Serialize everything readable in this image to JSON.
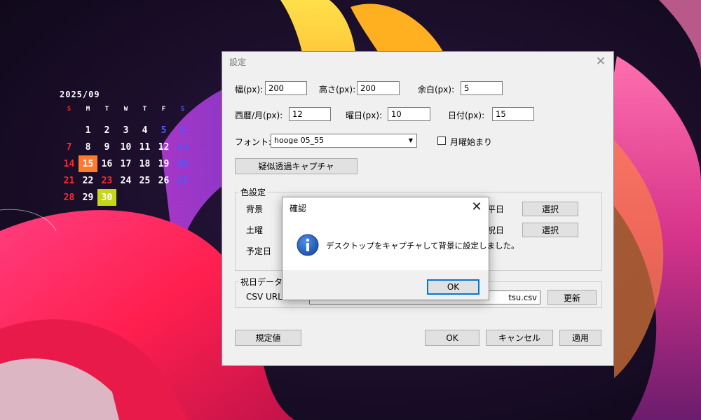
{
  "calendar": {
    "month": "2025/09",
    "weekdays": [
      "S",
      "M",
      "T",
      "W",
      "T",
      "F",
      "S"
    ],
    "days": [
      {
        "d": "",
        "c": ""
      },
      {
        "d": "1",
        "c": ""
      },
      {
        "d": "2",
        "c": ""
      },
      {
        "d": "3",
        "c": ""
      },
      {
        "d": "4",
        "c": ""
      },
      {
        "d": "5",
        "c": "sat"
      },
      {
        "d": "6",
        "c": "sat"
      },
      {
        "d": "7",
        "c": "sun"
      },
      {
        "d": "8",
        "c": ""
      },
      {
        "d": "9",
        "c": ""
      },
      {
        "d": "10",
        "c": ""
      },
      {
        "d": "11",
        "c": ""
      },
      {
        "d": "12",
        "c": ""
      },
      {
        "d": "13",
        "c": "sat"
      },
      {
        "d": "14",
        "c": "sun"
      },
      {
        "d": "15",
        "c": "today"
      },
      {
        "d": "16",
        "c": ""
      },
      {
        "d": "17",
        "c": ""
      },
      {
        "d": "18",
        "c": ""
      },
      {
        "d": "19",
        "c": ""
      },
      {
        "d": "20",
        "c": "sat"
      },
      {
        "d": "21",
        "c": "sun"
      },
      {
        "d": "22",
        "c": ""
      },
      {
        "d": "23",
        "c": "hol"
      },
      {
        "d": "24",
        "c": ""
      },
      {
        "d": "25",
        "c": ""
      },
      {
        "d": "26",
        "c": ""
      },
      {
        "d": "27",
        "c": "sat"
      },
      {
        "d": "28",
        "c": "sun"
      },
      {
        "d": "29",
        "c": ""
      },
      {
        "d": "30",
        "c": "mark"
      }
    ]
  },
  "settings": {
    "title": "設定",
    "width_label": "幅(px):",
    "width_value": "200",
    "height_label": "高さ(px):",
    "height_value": "200",
    "margin_label": "余白(px):",
    "margin_value": "5",
    "year_month_label": "西暦/月(px):",
    "year_month_value": "12",
    "weekday_label": "曜日(px):",
    "weekday_value": "10",
    "date_label": "日付(px):",
    "date_value": "15",
    "font_label": "フォント:",
    "font_value": "hooge 05_55",
    "monday_start_label": "月曜始まり",
    "capture_button": "疑似透過キャプチャ",
    "color_group_title": "色設定",
    "color_background_label": "背景",
    "color_saturday_label": "土曜",
    "color_schedule_label": "予定日",
    "color_weekday_label_partial": "平日",
    "color_holiday_label_partial": "祝日",
    "select_button": "選択",
    "holiday_group_title": "祝日データー",
    "csv_label": "CSV URL:",
    "csv_value_partial": "tsu.csv",
    "update_button": "更新",
    "defaults_button": "規定値",
    "ok_button": "OK",
    "cancel_button": "キャンセル",
    "apply_button": "適用"
  },
  "message_box": {
    "title": "確認",
    "text": "デスクトップをキャプチャして背景に設定しました。",
    "ok_button": "OK"
  },
  "colors": {
    "today": "#ff7a2a",
    "marked": "#c8d61a",
    "sunday": "#ff2a2a",
    "saturday": "#4a5bff",
    "focus": "#0078d7"
  }
}
